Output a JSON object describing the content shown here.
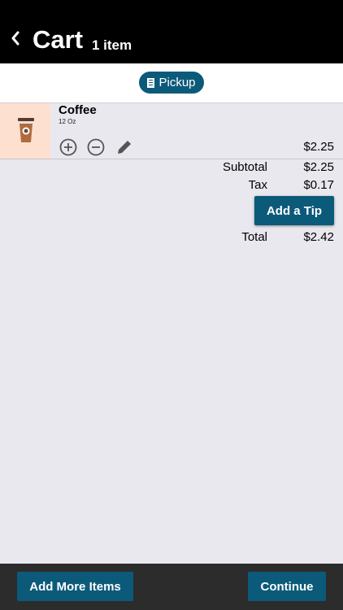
{
  "header": {
    "title": "Cart",
    "item_count": "1 item"
  },
  "order_mode": {
    "label": "Pickup",
    "icon": "building-icon"
  },
  "items": [
    {
      "name": "Coffee",
      "size": "12 Oz",
      "price": "$2.25",
      "icon": "coffee-cup-icon"
    }
  ],
  "summary": {
    "subtotal_label": "Subtotal",
    "subtotal": "$2.25",
    "tax_label": "Tax",
    "tax": "$0.17",
    "tip_button": "Add a Tip",
    "total_label": "Total",
    "total": "$2.42"
  },
  "footer": {
    "add_more": "Add More Items",
    "continue": "Continue"
  },
  "colors": {
    "accent": "#0c5a7a",
    "header_bg": "#000000",
    "footer_bg": "#2c2c2c",
    "thumb_bg": "#fde0cf",
    "page_bg": "#e8e8ee"
  }
}
